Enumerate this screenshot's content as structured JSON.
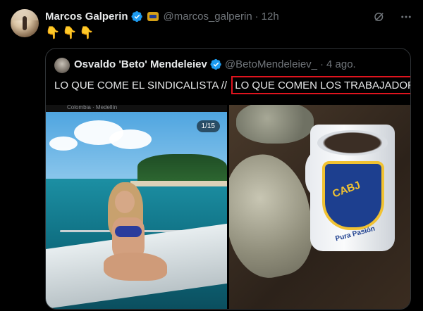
{
  "tweet": {
    "author_name": "Marcos Galperin",
    "handle": "@marcos_galperin",
    "separator": "·",
    "time": "12h",
    "emojis": "👇👇👇"
  },
  "icons": {
    "grok": "grok-icon",
    "more": "more-icon"
  },
  "quote": {
    "author_name": "Osvaldo 'Beto' Mendeleiev",
    "handle": "@BetoMendeleiev_",
    "separator": "·",
    "date": "4 ago.",
    "text_part1": "LO QUE COME EL SINDICALISTA //",
    "text_highlight": "LO QUE COMEN LOS TRABAJADORES",
    "media": {
      "left_caption": "Colombia · Medellín",
      "counter": "1/15",
      "mug_logo": "CABJ",
      "mug_text": "Pura Pasión"
    }
  },
  "colors": {
    "background": "#000000",
    "text": "#e7e9ea",
    "muted": "#71767b",
    "verified": "#1d9bf0",
    "highlight_box": "#e0141e",
    "border": "#2f3336"
  }
}
